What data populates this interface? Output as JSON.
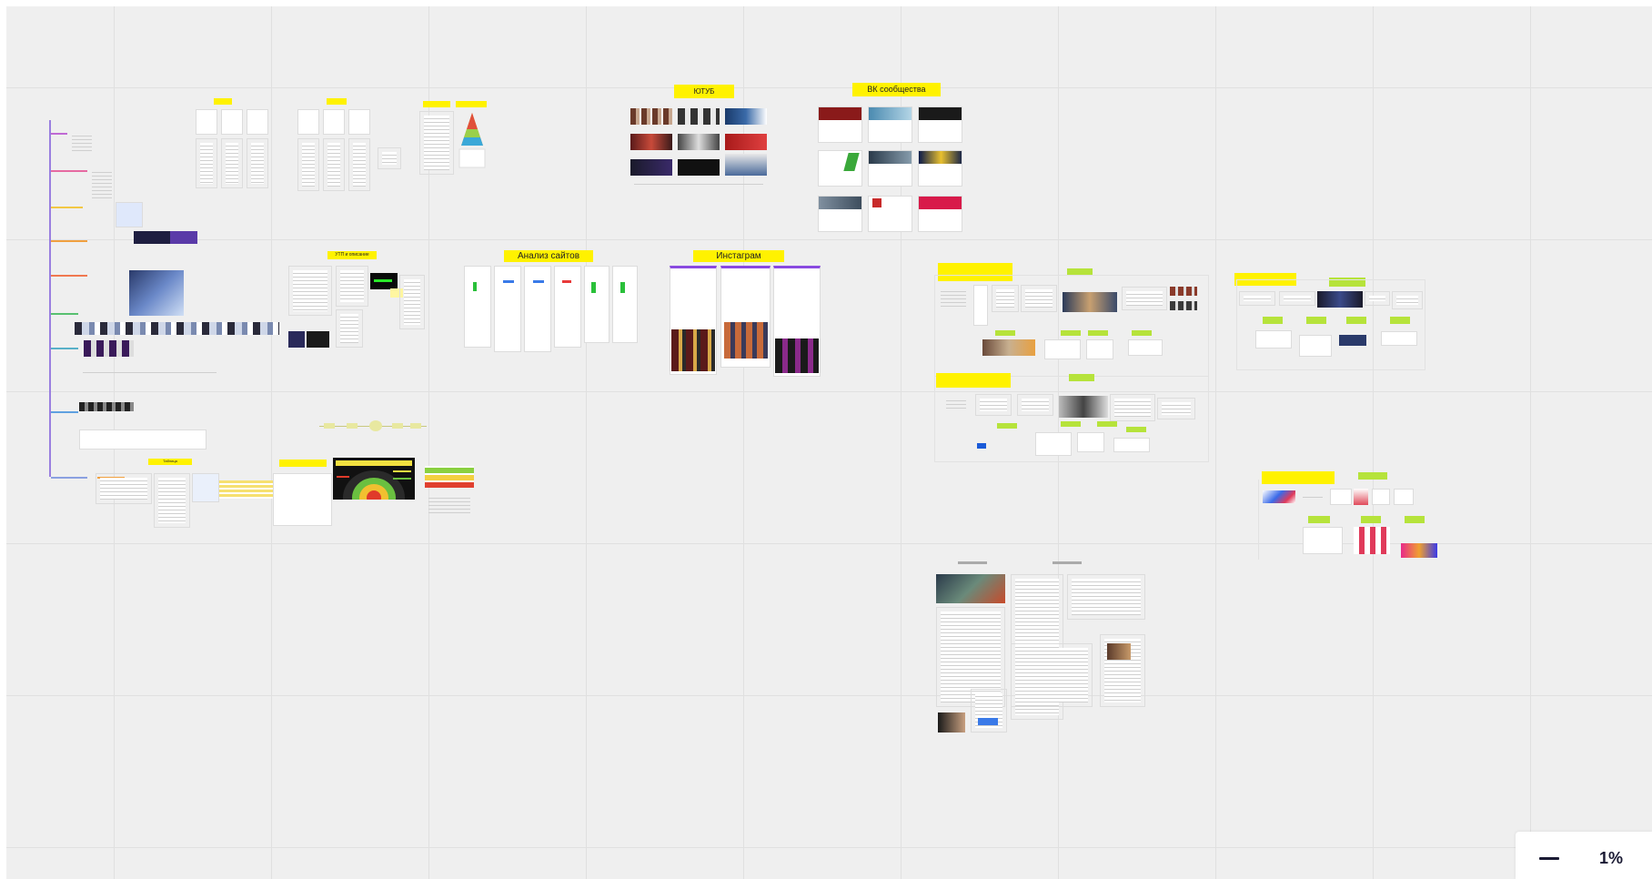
{
  "board": {
    "frames": [
      {
        "id": "youtube",
        "label": "ЮТУБ"
      },
      {
        "id": "vk",
        "label": "ВК сообщества"
      },
      {
        "id": "site-analysis",
        "label": "Анализ сайтов"
      },
      {
        "id": "instagram",
        "label": "Инстаграм"
      }
    ],
    "small_labels": [
      "УТП и описание",
      "Таблица",
      "Пирамида"
    ]
  },
  "zoom": {
    "level": "1%",
    "minus_icon": "minus-icon"
  }
}
